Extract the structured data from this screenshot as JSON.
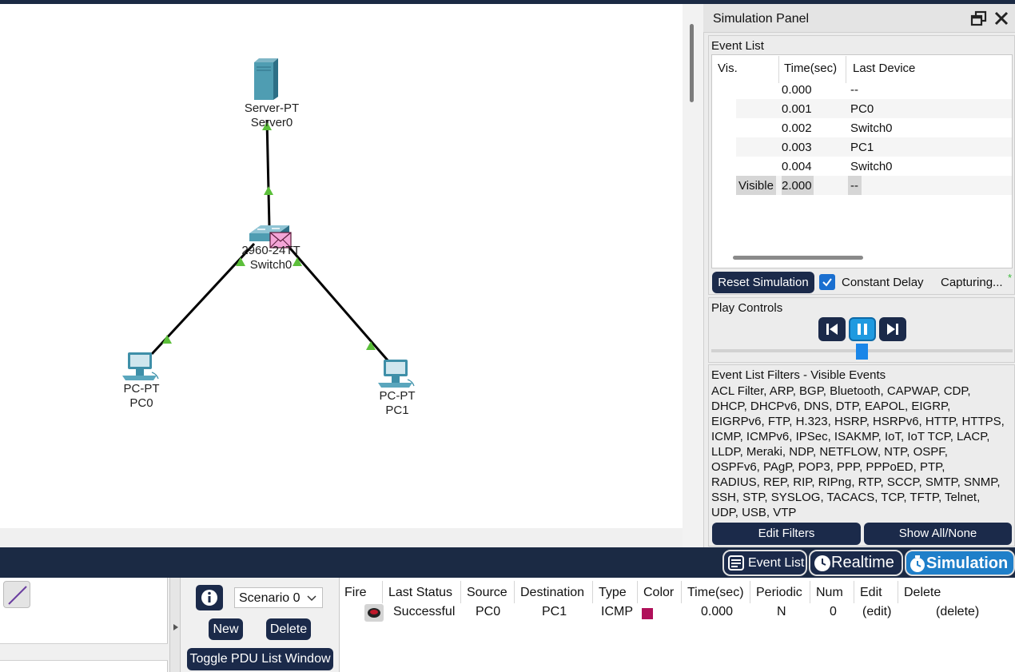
{
  "topology": {
    "server": {
      "model": "Server-PT",
      "name": "Server0"
    },
    "switch": {
      "model": "2960-24TT",
      "name": "Switch0"
    },
    "pc0": {
      "model": "PC-PT",
      "name": "PC0"
    },
    "pc1": {
      "model": "PC-PT",
      "name": "PC1"
    }
  },
  "sim_panel": {
    "title": "Simulation Panel",
    "event_list_title": "Event List",
    "columns": [
      "Vis.",
      "Time(sec)",
      "Last Device"
    ],
    "events": [
      {
        "vis": "",
        "time": "0.000",
        "device": "--"
      },
      {
        "vis": "",
        "time": "0.001",
        "device": "PC0"
      },
      {
        "vis": "",
        "time": "0.002",
        "device": "Switch0"
      },
      {
        "vis": "",
        "time": "0.003",
        "device": "PC1"
      },
      {
        "vis": "",
        "time": "0.004",
        "device": "Switch0"
      },
      {
        "vis": "Visible",
        "time": "2.000",
        "device": "--"
      }
    ],
    "reset_label": "Reset Simulation",
    "constant_delay_label": "Constant Delay",
    "capturing_label": "Capturing...",
    "capturing_mark": "*",
    "play_controls_title": "Play Controls",
    "filters_title": "Event List Filters - Visible Events",
    "filters_lines": [
      "ACL Filter, ARP, BGP, Bluetooth, CAPWAP, CDP,",
      "DHCP, DHCPv6, DNS, DTP, EAPOL, EIGRP,",
      "EIGRPv6, FTP, H.323, HSRP, HSRPv6, HTTP, HTTPS,",
      "ICMP, ICMPv6, IPSec, ISAKMP, IoT, IoT TCP, LACP,",
      "LLDP, Meraki, NDP, NETFLOW, NTP, OSPF,",
      "OSPFv6, PAgP, POP3, PPP, PPPoED, PTP,",
      "RADIUS, REP, RIP, RIPng, RTP, SCCP, SMTP, SNMP,",
      "SSH, STP, SYSLOG, TACACS, TCP, TFTP, Telnet,",
      "UDP, USB, VTP"
    ],
    "edit_filters_label": "Edit Filters",
    "show_all_label": "Show All/None"
  },
  "mode_bar": {
    "event_list_label": "Event List",
    "realtime_label": "Realtime",
    "simulation_label": "Simulation"
  },
  "scenario": {
    "selected": "Scenario 0",
    "new_label": "New",
    "delete_label": "Delete",
    "toggle_label": "Toggle PDU List Window"
  },
  "pdu_list": {
    "columns": [
      "Fire",
      "Last Status",
      "Source",
      "Destination",
      "Type",
      "Color",
      "Time(sec)",
      "Periodic",
      "Num",
      "Edit",
      "Delete"
    ],
    "rows": [
      {
        "last_status": "Successful",
        "source": "PC0",
        "destination": "PC1",
        "type": "ICMP",
        "color": "#b0105a",
        "time": "0.000",
        "periodic": "N",
        "num": "0",
        "edit": "(edit)",
        "delete": "(delete)"
      }
    ]
  },
  "colors": {
    "dark_navy": "#1b2a4a",
    "accent_blue": "#1f7fc9",
    "link_green": "#5cbf3a",
    "pdu_pink": "#f4a6d7"
  }
}
